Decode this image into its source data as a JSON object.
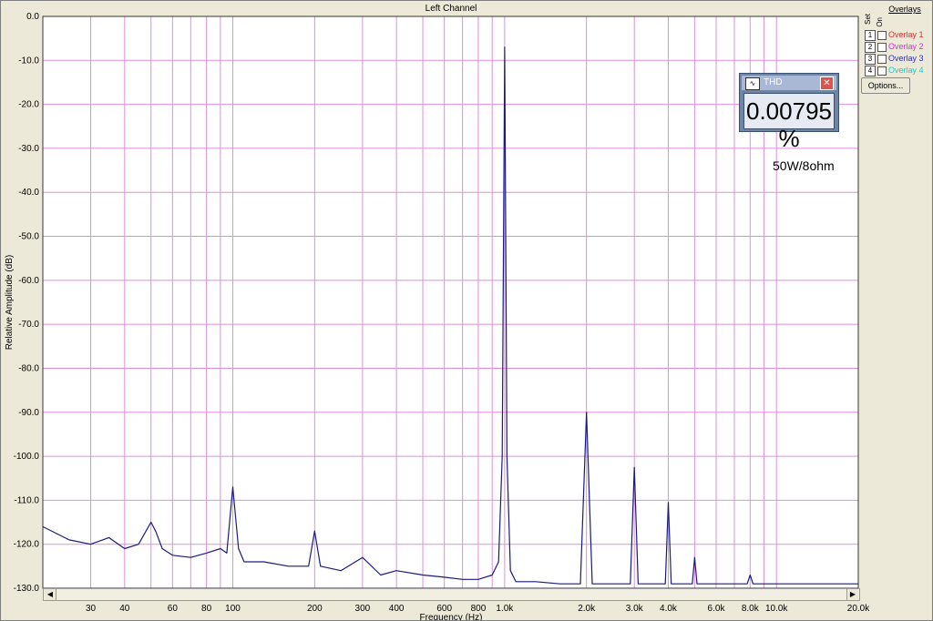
{
  "chart_data": {
    "type": "line",
    "title": "Left Channel",
    "xlabel": "Frequency (Hz)",
    "ylabel": "Relative Amplitude (dB)",
    "xscale": "log",
    "xlim": [
      20,
      20000
    ],
    "ylim": [
      -130,
      0
    ],
    "grid": true,
    "yticks": [
      0,
      -10,
      -20,
      -30,
      -40,
      -50,
      -60,
      -70,
      -80,
      -90,
      -100,
      -110,
      -120,
      -130
    ],
    "ytick_labels": [
      "0.0",
      "-10.0",
      "-20.0",
      "-30.0",
      "-40.0",
      "-50.0",
      "-60.0",
      "-70.0",
      "-80.0",
      "-90.0",
      "-100.0",
      "-110.0",
      "-120.0",
      "-130.0"
    ],
    "xticks": [
      30,
      40,
      60,
      80,
      100,
      200,
      300,
      400,
      600,
      800,
      1000,
      2000,
      3000,
      4000,
      6000,
      8000,
      10000,
      20000
    ],
    "xtick_labels": [
      "30",
      "40",
      "60",
      "80",
      "100",
      "200",
      "300",
      "400",
      "600",
      "800",
      "1.0k",
      "2.0k",
      "3.0k",
      "4.0k",
      "6.0k",
      "8.0k",
      "10.0k",
      "20.0k"
    ],
    "series": [
      {
        "color": "#1a1a80",
        "x": [
          20,
          25,
          30,
          35,
          40,
          45,
          50,
          52,
          55,
          60,
          70,
          80,
          90,
          95,
          100,
          105,
          110,
          130,
          160,
          190,
          200,
          210,
          250,
          300,
          350,
          400,
          500,
          600,
          700,
          800,
          900,
          950,
          980,
          1000,
          1020,
          1050,
          1100,
          1300,
          1600,
          1900,
          2000,
          2100,
          2500,
          2900,
          3000,
          3100,
          3500,
          3900,
          4000,
          4100,
          4600,
          4900,
          5000,
          5100,
          6000,
          7000,
          7800,
          8000,
          8200,
          9000,
          10000,
          12000,
          15000,
          18000,
          20000
        ],
        "y": [
          -116,
          -119,
          -120,
          -118.5,
          -121,
          -120,
          -115,
          -117,
          -121,
          -122.5,
          -123,
          -122,
          -121,
          -122,
          -107,
          -121,
          -124,
          -124,
          -125,
          -125,
          -117,
          -125,
          -126,
          -123,
          -127,
          -126,
          -127,
          -127.5,
          -128,
          -128,
          -127,
          -124,
          -100,
          -7,
          -100,
          -126,
          -128.5,
          -128.5,
          -129,
          -129,
          -90,
          -129,
          -129,
          -129,
          -102.5,
          -129,
          -129,
          -129,
          -110.5,
          -129,
          -129,
          -129,
          -123,
          -129,
          -129,
          -129,
          -129,
          -127,
          -129,
          -129,
          -129,
          -129,
          -129,
          -129,
          -129
        ]
      }
    ]
  },
  "overlays": {
    "title": "Overlays",
    "set_label": "Set",
    "on_label": "On",
    "items": [
      {
        "num": "1",
        "label": "Overlay 1",
        "color": "#d83030"
      },
      {
        "num": "2",
        "label": "Overlay 2",
        "color": "#d830d8"
      },
      {
        "num": "3",
        "label": "Overlay 3",
        "color": "#3030c0"
      },
      {
        "num": "4",
        "label": "Overlay 4",
        "color": "#20c8c8"
      }
    ],
    "options_label": "Options..."
  },
  "thd_meter": {
    "title": "THD",
    "value": "0.00795 %"
  },
  "annotation": "50W/8ohm",
  "colors": {
    "grid": "#e08ee0",
    "plot_bg": "#ffffff",
    "trace": "#1a1a80"
  },
  "icons": {
    "scroll_left": "triangle-left-icon",
    "scroll_right": "triangle-right-icon",
    "meter": "waveform-icon",
    "close": "close-icon"
  }
}
